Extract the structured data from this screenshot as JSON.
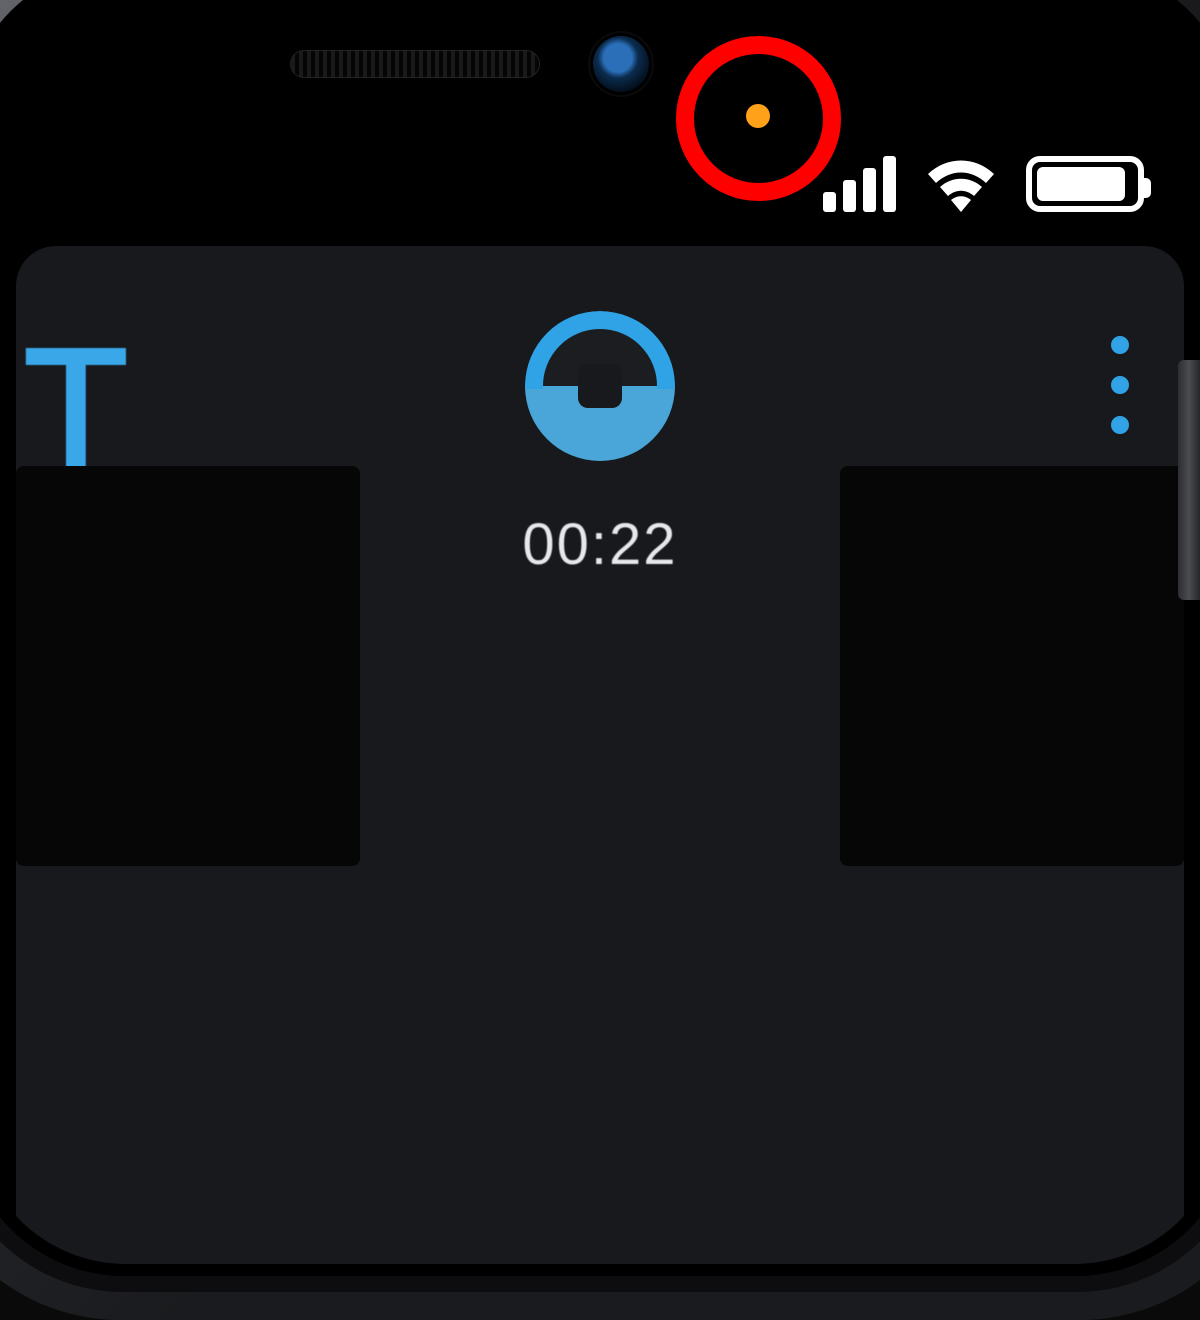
{
  "status_bar": {
    "privacy_indicator": {
      "color": "#ffa21a",
      "meaning": "microphone-in-use"
    },
    "cellular_bars": 4,
    "wifi_strength": 3,
    "battery_percent_approx": 92
  },
  "annotation": {
    "ring_color": "#ff0000",
    "target": "privacy-indicator-dot"
  },
  "app": {
    "partial_letter": "T",
    "center_icon_name": "contact-avatar",
    "overflow_icon_name": "more-vertical",
    "call_timer": "00:22",
    "accent_color": "#2fa3e6"
  }
}
